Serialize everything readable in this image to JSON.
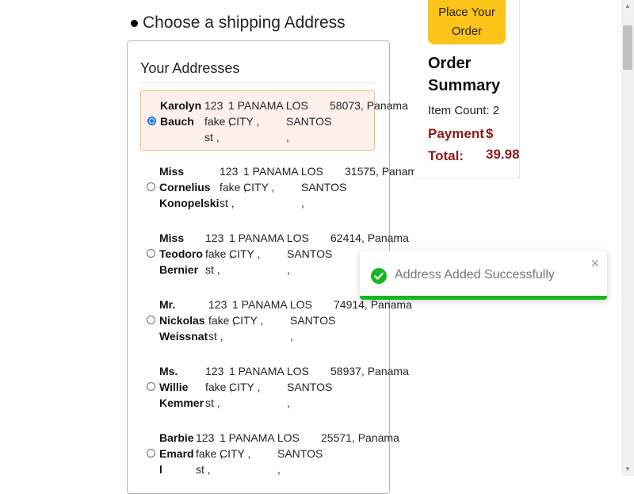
{
  "heading": "Choose a shipping Address",
  "card_title": "Your Addresses",
  "addresses": [
    {
      "name": [
        "Karolyn",
        "Bauch"
      ],
      "street": [
        "123",
        "fake ,",
        "st ,"
      ],
      "city": [
        "1 PANAMA LOS",
        "CITY ,",
        ""
      ],
      "state": [
        "",
        "SANTOS",
        ","
      ],
      "zip": "58073, Panama",
      "selected": true
    },
    {
      "name": [
        "Miss",
        "Cornelius",
        "Konopelski"
      ],
      "street": [
        "123",
        "fake ,",
        "st ,"
      ],
      "city": [
        "1 PANAMA LOS",
        "CITY ,",
        ""
      ],
      "state": [
        "",
        "SANTOS",
        ","
      ],
      "zip": "31575, Panama",
      "selected": false
    },
    {
      "name": [
        "Miss",
        "Teodoro",
        "Bernier"
      ],
      "street": [
        "123",
        "fake ,",
        "st ,"
      ],
      "city": [
        "1 PANAMA LOS",
        "CITY ,",
        ""
      ],
      "state": [
        "",
        "SANTOS",
        ","
      ],
      "zip": "62414, Panama",
      "selected": false
    },
    {
      "name": [
        "Mr.",
        "Nickolas",
        "Weissnat"
      ],
      "street": [
        "123",
        "fake ,",
        "st ,"
      ],
      "city": [
        "1 PANAMA LOS",
        "CITY ,",
        ""
      ],
      "state": [
        "",
        "SANTOS",
        ","
      ],
      "zip": "74914, Panama",
      "selected": false
    },
    {
      "name": [
        "Ms.",
        "Willie",
        "Kemmer"
      ],
      "street": [
        "123",
        "fake ,",
        "st ,"
      ],
      "city": [
        "1 PANAMA LOS",
        "CITY ,",
        ""
      ],
      "state": [
        "",
        "SANTOS",
        ","
      ],
      "zip": "58937, Panama",
      "selected": false
    },
    {
      "name": [
        "Barbie",
        "Emard",
        "l"
      ],
      "street": [
        "123",
        "fake ,",
        "st ,"
      ],
      "city": [
        "1 PANAMA LOS",
        "CITY ,",
        ""
      ],
      "state": [
        "",
        "SANTOS",
        ","
      ],
      "zip": "25571, Panama",
      "selected": false
    }
  ],
  "order": {
    "place_button": [
      "Place Your",
      "Order"
    ],
    "summary_title": [
      "Order",
      "Summary"
    ],
    "item_count": "Item Count: 2",
    "payment_label": [
      "Payment",
      "Total:"
    ],
    "currency": "$",
    "total": "39.98"
  },
  "toast": {
    "message": "Address Added Successfully",
    "close": "×",
    "icon": "check-circle-icon"
  },
  "colors": {
    "accent": "#fcc419",
    "total": "#8b1a1a",
    "success": "#15b71f",
    "selected_bg": "#fff0ec"
  }
}
